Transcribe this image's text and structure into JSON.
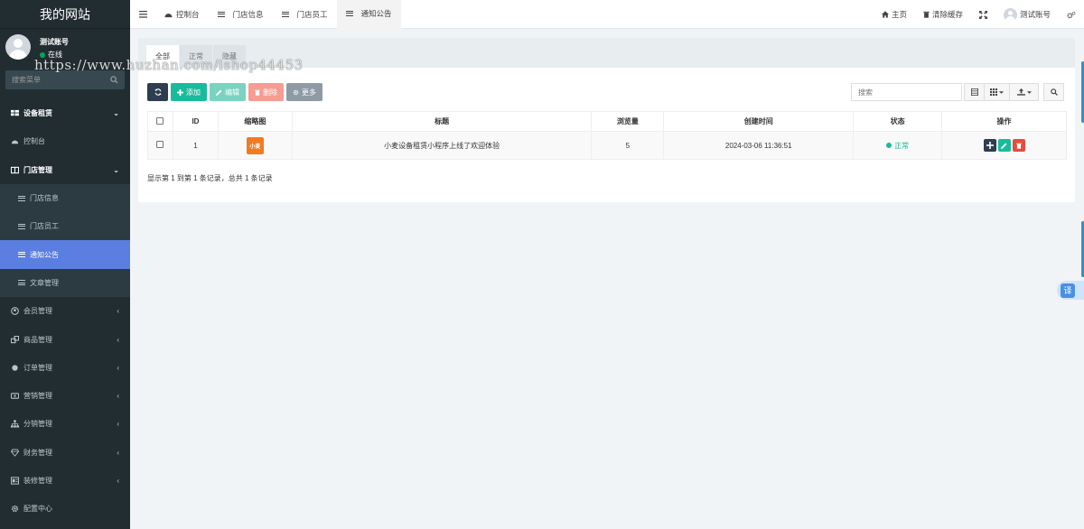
{
  "sidebar": {
    "brand": "我的网站",
    "user": {
      "name": "测试账号",
      "status": "在线"
    },
    "search_placeholder": "搜索菜单",
    "items": [
      {
        "label": "设备租赁",
        "icon": "table-icon",
        "arrow": "⌄"
      },
      {
        "label": "控制台",
        "icon": "dashboard-icon",
        "arrow": ""
      },
      {
        "label": "门店管理",
        "icon": "store-icon",
        "arrow": "⌄"
      },
      {
        "label": "门店信息",
        "icon": "list-icon",
        "arrow": ""
      },
      {
        "label": "门店员工",
        "icon": "list-icon",
        "arrow": ""
      },
      {
        "label": "通知公告",
        "icon": "list-icon",
        "arrow": ""
      },
      {
        "label": "文章管理",
        "icon": "list-icon",
        "arrow": ""
      },
      {
        "label": "会员管理",
        "icon": "user-icon",
        "arrow": "‹"
      },
      {
        "label": "商品管理",
        "icon": "goods-icon",
        "arrow": "‹"
      },
      {
        "label": "订单管理",
        "icon": "order-icon",
        "arrow": "‹"
      },
      {
        "label": "营销管理",
        "icon": "marketing-icon",
        "arrow": "‹"
      },
      {
        "label": "分销管理",
        "icon": "sitemap-icon",
        "arrow": "‹"
      },
      {
        "label": "财务管理",
        "icon": "diamond-icon",
        "arrow": "‹"
      },
      {
        "label": "装修管理",
        "icon": "decorate-icon",
        "arrow": "‹"
      },
      {
        "label": "配置中心",
        "icon": "gear-icon",
        "arrow": ""
      }
    ]
  },
  "watermark": "https://www.huzhan.com/ishop44453",
  "topbar": {
    "tabs": [
      "控制台",
      "门店信息",
      "门店员工",
      "通知公告"
    ],
    "right": {
      "home": "主页",
      "clear_cache": "清除缓存",
      "account": "测试账号"
    }
  },
  "filter_tabs": [
    "全部",
    "正常",
    "隐藏"
  ],
  "toolbar": {
    "add": "添加",
    "edit": "编辑",
    "delete": "删除",
    "more": "更多"
  },
  "search": {
    "placeholder": "搜索"
  },
  "table": {
    "headers": [
      "ID",
      "缩略图",
      "标题",
      "浏览量",
      "创建时间",
      "状态",
      "操作"
    ],
    "rows": [
      {
        "id": "1",
        "thumb": "小麦",
        "title": "小麦设备租赁小程序上线了欢迎体验",
        "views": "5",
        "created": "2024-03-06 11:36:51",
        "status": "正常"
      }
    ]
  },
  "summary": "显示第 1 到第 1 条记录，总共 1 条记录",
  "translate_label": "译",
  "colors": {
    "sidebar_bg": "#222d32",
    "active": "#5b7fe0",
    "success": "#18bc9c",
    "danger": "#e74c3c",
    "dark": "#2c3e50"
  }
}
